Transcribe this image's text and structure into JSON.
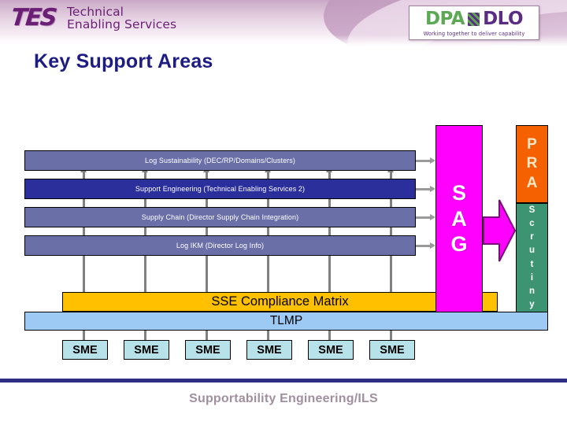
{
  "header": {
    "tes_logo": {
      "mark": "TES",
      "line1": "Technical",
      "line2": "Enabling Services"
    },
    "dpa_dlo_logo": {
      "left": "DPA",
      "right": "DLO",
      "tagline": "Working together to deliver capability"
    }
  },
  "page_title": "Key Support Areas",
  "diagram": {
    "capability_bars": [
      {
        "label": "Log Sustainability (DEC/RP/Domains/Clusters)",
        "color": "#6b6fa8"
      },
      {
        "label": "Support Engineering (Technical Enabling Services 2)",
        "color": "#2b2f9c"
      },
      {
        "label": "Supply Chain (Director Supply Chain Integration)",
        "color": "#6b6fa8"
      },
      {
        "label": "Log IKM (Director Log Info)",
        "color": "#6b6fa8"
      }
    ],
    "sse_bar": {
      "label": "SSE Compliance Matrix",
      "color": "#ffc000"
    },
    "tlmp_bar": {
      "label": "TLMP",
      "color": "#9dc9f5"
    },
    "sme_boxes": [
      {
        "label": "SME"
      },
      {
        "label": "SME"
      },
      {
        "label": "SME"
      },
      {
        "label": "SME"
      },
      {
        "label": "SME"
      },
      {
        "label": "SME"
      }
    ],
    "sag": {
      "letters": [
        "S",
        "A",
        "G"
      ],
      "color": "#ff00ff"
    },
    "pra": {
      "letters": [
        "P",
        "R",
        "A"
      ],
      "color": "#f56000"
    },
    "scrutiny": {
      "letters": [
        "S",
        "c",
        "r",
        "u",
        "t",
        "i",
        "n",
        "y"
      ],
      "color": "#3d9472"
    }
  },
  "footer": {
    "text": "Supportability Engineering/ILS",
    "rule_color": "#2e2e82"
  }
}
